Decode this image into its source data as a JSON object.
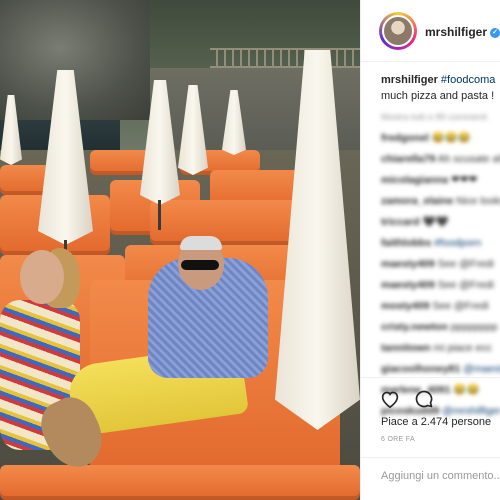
{
  "post": {
    "username": "mrshilfiger",
    "caption_hashtag": "#foodcoma",
    "caption_text": "much pizza and pasta !",
    "likes_text": "Piace a 2.474 persone",
    "time_text": "6 ORE FA",
    "comment_placeholder": "Aggiungi un commento..."
  },
  "comments": [
    {
      "user": "Mostra tutti e 89 commenti",
      "text": "",
      "faint": true
    },
    {
      "user": "fredgonel",
      "text": "😂😂😂"
    },
    {
      "user": "chiarella79",
      "text": "Ah scusate ahah"
    },
    {
      "user": "micolagianna",
      "text": "❤❤❤"
    },
    {
      "user": "zamora_elaine",
      "text": "Nice looks pasta"
    },
    {
      "user": "triccard",
      "text": "🖤🖤"
    },
    {
      "user": "faithlobbs",
      "text": "#foodporn"
    },
    {
      "user": "maesty409",
      "text": "See @Fredi"
    },
    {
      "user": "maesty409",
      "text": "See @Fredi"
    },
    {
      "user": "mosty409",
      "text": "See @Fredi"
    },
    {
      "user": "cristy.newton",
      "text": "pppppppp"
    },
    {
      "user": "tannitown",
      "text": "mi piace ecc"
    },
    {
      "user": "giacoolhoney81",
      "text": "@maesty"
    },
    {
      "user": "marlene_4091",
      "text": "😂😂"
    },
    {
      "user": "picoskudd9",
      "text": "@mrshilfiger"
    }
  ],
  "icons": {
    "verified": "verified-badge-icon",
    "like": "heart-icon",
    "comment": "speech-bubble-icon"
  },
  "colors": {
    "link": "#003569",
    "verified": "#3897f0",
    "lounger": "#e2682c"
  }
}
